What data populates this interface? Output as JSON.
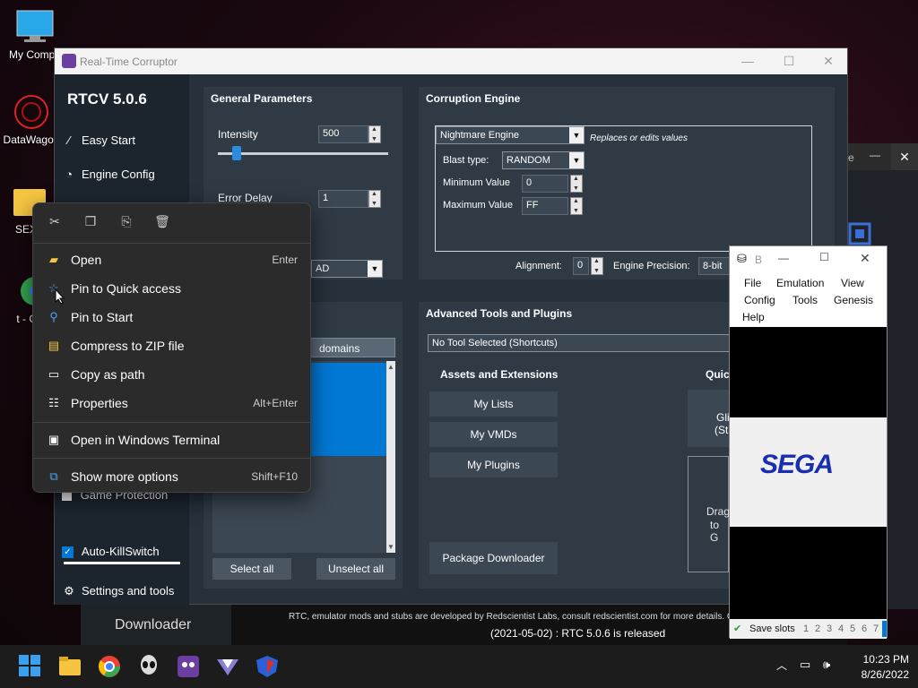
{
  "desktop": {
    "icons": [
      {
        "label": "My Compu"
      },
      {
        "label": "DataWagon"
      },
      {
        "label": "SEXY"
      },
      {
        "label": "t - Cl"
      }
    ]
  },
  "rtc": {
    "window_title": "Real-Time Corruptor",
    "version": "RTCV 5.0.6",
    "sidebar": {
      "easy_start": "Easy Start",
      "engine_config": "Engine Config",
      "game_protection": "Game Protection",
      "auto_killswitch": "Auto-KillSwitch",
      "settings": "Settings and tools"
    },
    "general": {
      "header": "General Parameters",
      "intensity_label": "Intensity",
      "intensity_value": "500",
      "error_delay_label": "Error Delay",
      "error_delay_value": "1",
      "dropdown_value": "AD"
    },
    "engine": {
      "header": "Corruption Engine",
      "engine_select": "Nightmare Engine",
      "engine_desc": "Replaces or edits values",
      "blast_type_label": "Blast type:",
      "blast_type_value": "RANDOM",
      "min_label": "Minimum Value",
      "min_value": "0",
      "max_label": "Maximum Value",
      "max_value": "FF",
      "alignment_label": "Alignment:",
      "alignment_value": "0",
      "precision_label": "Engine Precision:",
      "precision_value": "8-bit"
    },
    "domains": {
      "tab_label": "domains",
      "select_all": "Select all",
      "unselect_all": "Unselect all"
    },
    "advanced": {
      "header": "Advanced Tools and Plugins",
      "tool_select": "No Tool Selected (Shortcuts)",
      "assets_header": "Assets and Extensions",
      "my_lists": "My Lists",
      "my_vmds": "My VMDs",
      "my_plugins": "My Plugins",
      "package_downloader": "Package Downloader",
      "quick_header": "Quic",
      "gli_btn": "Gli",
      "sta_btn": "(Sta",
      "drag_text1": "Drag",
      "drag_text2": "to G"
    },
    "footer": {
      "credits": "RTC, emulator mods and stubs are developed by Redscientist Labs, consult redscientist.com for more details. Clic",
      "news": "(2021-05-02) : RTC 5.0.6 is released",
      "downloader": "Downloader"
    }
  },
  "context_menu": {
    "items": [
      {
        "label": "Open",
        "shortcut": "Enter"
      },
      {
        "label": "Pin to Quick access",
        "shortcut": ""
      },
      {
        "label": "Pin to Start",
        "shortcut": ""
      },
      {
        "label": "Compress to ZIP file",
        "shortcut": ""
      },
      {
        "label": "Copy as path",
        "shortcut": ""
      },
      {
        "label": "Properties",
        "shortcut": "Alt+Enter"
      },
      {
        "label": "Open in Windows Terminal",
        "shortcut": ""
      },
      {
        "label": "Show more options",
        "shortcut": "Shift+F10"
      }
    ]
  },
  "emulator": {
    "title": "B",
    "menu": [
      "File",
      "Emulation",
      "View",
      "Config",
      "Tools",
      "Genesis",
      "Help"
    ],
    "logo": "SEGA",
    "save_slots_label": "Save slots",
    "slots": [
      "1",
      "2",
      "3",
      "4",
      "5",
      "6",
      "7"
    ]
  },
  "background_window": {
    "title_fragment": "e"
  },
  "taskbar": {
    "time": "10:23 PM",
    "date": "8/26/2022"
  },
  "colors": {
    "accent": "#0078d4",
    "rtc_bg": "#27313b",
    "panel_bg": "#2f3a45",
    "sega_blue": "#1a2fb0"
  }
}
